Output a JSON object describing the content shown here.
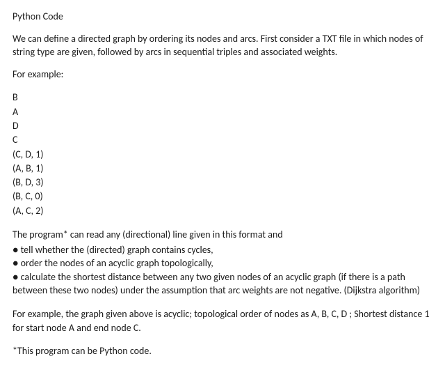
{
  "title": "Python Code",
  "intro": "We can define a directed graph by ordering its nodes and arcs. First consider a TXT file in which nodes of string type are given, followed by arcs in sequential triples and associated weights.",
  "for_example": "For example:",
  "data_lines": [
    "B",
    "A",
    "D",
    "C",
    "(C, D, 1)",
    "(A, B, 1)",
    "(B, D, 3)",
    "(B, C, 0)",
    "(A, C, 2)"
  ],
  "desc_intro": "The program* can read any (directional) line given in this format and",
  "bullets": [
    "● tell whether the (directed) graph contains cycles,",
    "● order the nodes of an acyclic graph topologically,",
    "● calculate the shortest distance between any two given nodes of an acyclic graph (if there is a path between these two nodes) under the assumption that arc weights are not negative. (Dijkstra algorithm)"
  ],
  "example_result": "For example, the graph given above is acyclic; topological order of nodes as A, B, C, D ; Shortest distance 1 for start node A and end node C.",
  "footnote": "*This program can be Python code."
}
